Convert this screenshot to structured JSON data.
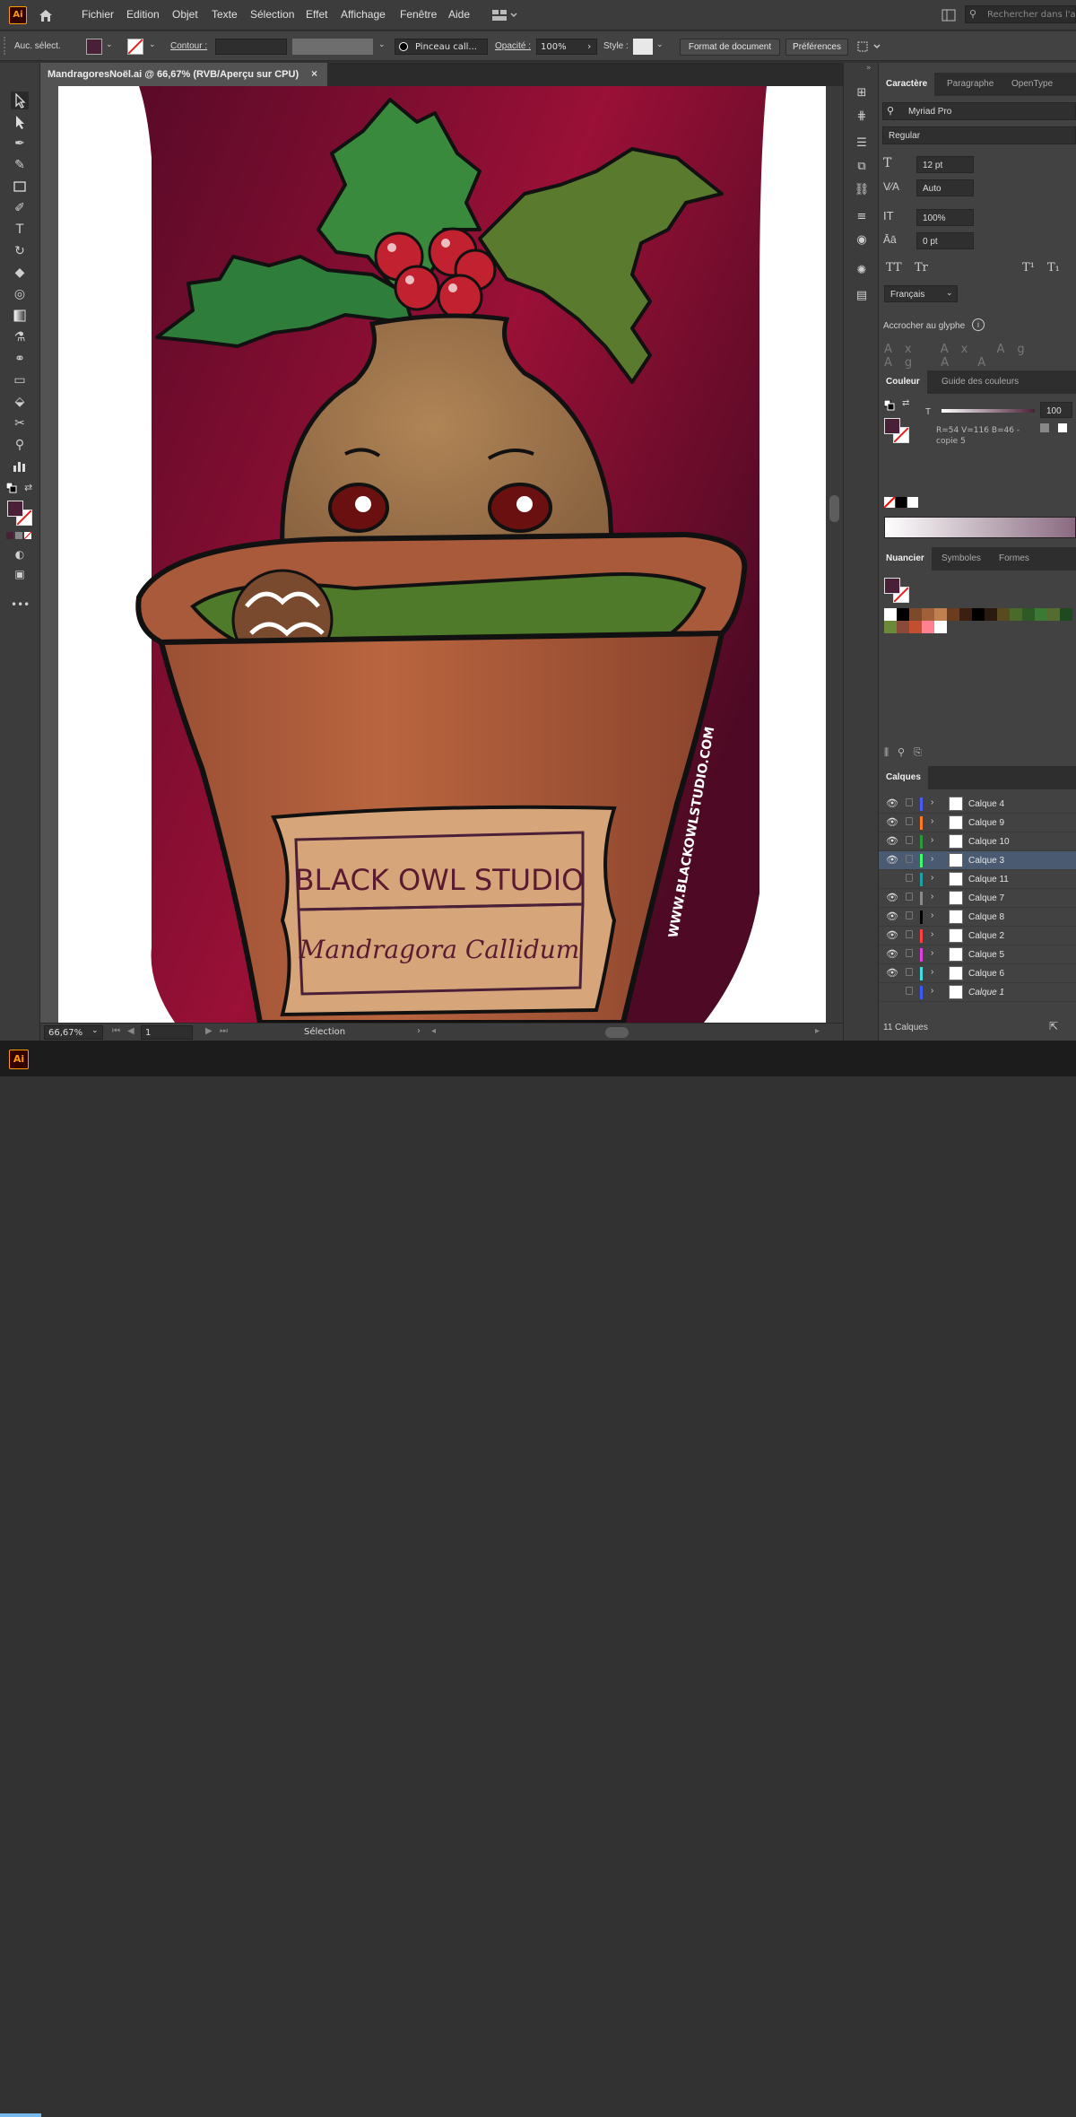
{
  "menubar": {
    "app_badge": "Ai",
    "items": [
      "Fichier",
      "Edition",
      "Objet",
      "Texte",
      "Sélection",
      "Effet",
      "Affichage",
      "Fenêtre",
      "Aide"
    ],
    "search_placeholder": "Rechercher dans l'aide"
  },
  "control_bar": {
    "selection_label": "Auc. sélect.",
    "contour_label": "Contour :",
    "brush_label": "Pinceau call...",
    "opacity_label": "Opacité :",
    "opacity_value": "100%",
    "style_label": "Style :",
    "doc_format_button": "Format de document",
    "preferences_button": "Préférences"
  },
  "document_tab": {
    "title": "MandragoresNoël.ai @ 66,67% (RVB/Aperçu sur CPU)",
    "close": "×"
  },
  "artwork": {
    "label_brand": "BLACK OWL STUDIO",
    "label_subtitle": "Mandragora Callidum",
    "side_url": "WWW.BLACKOWLSTUDIO.COM",
    "colors": {
      "bg_dark": "#5a0a28",
      "bg_mid": "#8c0f35",
      "pot": "#b5613e",
      "pot_dark": "#8d4630",
      "label": "#d6a57a",
      "root": "#a77a4d",
      "leaf": "#2f6b33",
      "berry": "#c2212f"
    }
  },
  "statusbar": {
    "zoom": "66,67%",
    "page": "1",
    "mode": "Sélection"
  },
  "character_panel": {
    "tabs": [
      "Caractère",
      "Paragraphe",
      "OpenType"
    ],
    "font_family": "Myriad Pro",
    "font_style": "Regular",
    "size": "12 pt",
    "leading": "Auto",
    "scale": "100%",
    "tracking": "0 pt",
    "language": "Français",
    "snap_label": "Accrocher au glyphe",
    "case_buttons": [
      "TT",
      "Tr",
      "T¹",
      "T₁"
    ]
  },
  "color_panel": {
    "tabs": [
      "Couleur",
      "Guide des couleurs"
    ],
    "tint_label": "T",
    "tint_value": "100",
    "color_info": "R=54 V=116 B=46 - copie 5",
    "fill_color": "#4a2038"
  },
  "swatches_panel": {
    "tabs": [
      "Nuancier",
      "Symboles",
      "Formes"
    ],
    "swatches": [
      "#ffffff",
      "#000000",
      "#7a4a2a",
      "#a0603a",
      "#c08050",
      "#6b3d1e",
      "#3b1f10",
      "#000000",
      "#2a1a10",
      "#5a4a20",
      "#4a6a2a",
      "#2f5a25",
      "#3a7a35",
      "#556b2f",
      "#1f4a20",
      "#6a8a3a",
      "#8a4a3a",
      "#c05030",
      "#ff8090",
      "#ffffff"
    ]
  },
  "layers_panel": {
    "tab": "Calques",
    "count": "11 Calques",
    "layers": [
      {
        "name": "Calque 4",
        "color": "#4a5aff",
        "visible": true,
        "selected": false,
        "italic": false
      },
      {
        "name": "Calque 9",
        "color": "#ff7a20",
        "visible": true,
        "selected": false,
        "italic": false
      },
      {
        "name": "Calque 10",
        "color": "#2a9a3a",
        "visible": true,
        "selected": false,
        "italic": false
      },
      {
        "name": "Calque 3",
        "color": "#3aff6a",
        "visible": true,
        "selected": true,
        "italic": false
      },
      {
        "name": "Calque 11",
        "color": "#20a0a0",
        "visible": false,
        "selected": false,
        "italic": false
      },
      {
        "name": "Calque 7",
        "color": "#8a8a8a",
        "visible": true,
        "selected": false,
        "italic": false
      },
      {
        "name": "Calque 8",
        "color": "#000000",
        "visible": true,
        "selected": false,
        "italic": false
      },
      {
        "name": "Calque 2",
        "color": "#ff4040",
        "visible": true,
        "selected": false,
        "italic": false
      },
      {
        "name": "Calque 5",
        "color": "#e040e0",
        "visible": true,
        "selected": false,
        "italic": false
      },
      {
        "name": "Calque 6",
        "color": "#40e0e0",
        "visible": true,
        "selected": false,
        "italic": false
      },
      {
        "name": "Calque 1",
        "color": "#3a5aff",
        "visible": false,
        "selected": false,
        "italic": true
      }
    ]
  }
}
